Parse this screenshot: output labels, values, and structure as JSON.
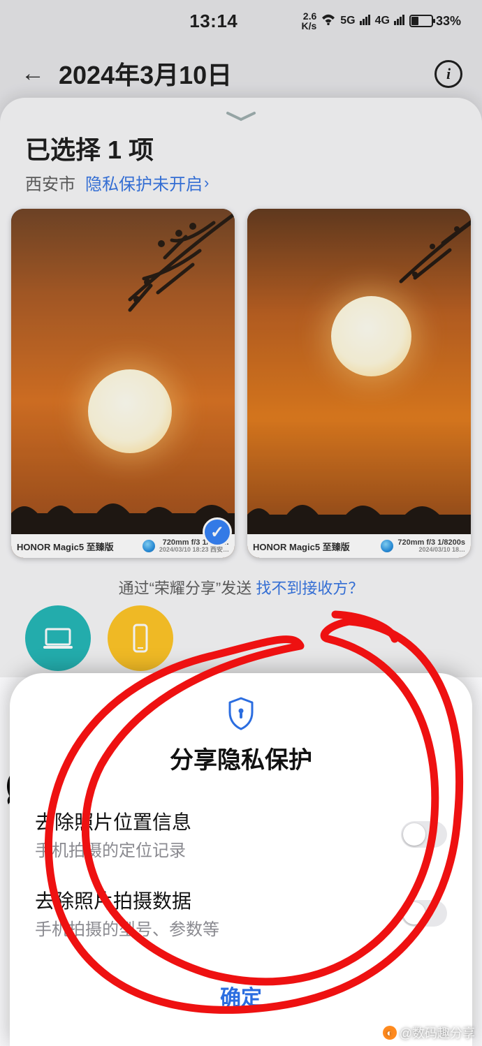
{
  "status": {
    "time": "13:14",
    "net_top": "2.6",
    "net_bottom": "K/s",
    "sig1": "5G",
    "sig2": "4G",
    "battery_pct": "33%"
  },
  "header": {
    "date": "2024年3月10日"
  },
  "sheet": {
    "selected_title": "已选择 1 项",
    "city": "西安市",
    "privacy_link": "隐私保护未开启",
    "honor_prefix": "通过“荣耀分享”发送 ",
    "honor_link": "找不到接收方？"
  },
  "thumbs": [
    {
      "device": "HONOR Magic5 至臻版",
      "meta_top": "720mm  f/3  1/580…",
      "meta_sub": "2024/03/10 18:23  西安…",
      "selected": true
    },
    {
      "device": "HONOR Magic5 至臻版",
      "meta_top": "720mm  f/3  1/8200s",
      "meta_sub": "2024/03/10 18…",
      "selected": false
    }
  ],
  "dialog": {
    "title": "分享隐私保护",
    "opt1_title": "去除照片位置信息",
    "opt1_sub": "手机拍摄的定位记录",
    "opt2_title": "去除照片拍摄数据",
    "opt2_sub": "手机拍摄的型号、参数等",
    "confirm": "确定"
  },
  "watermark": "@数码趣分享"
}
